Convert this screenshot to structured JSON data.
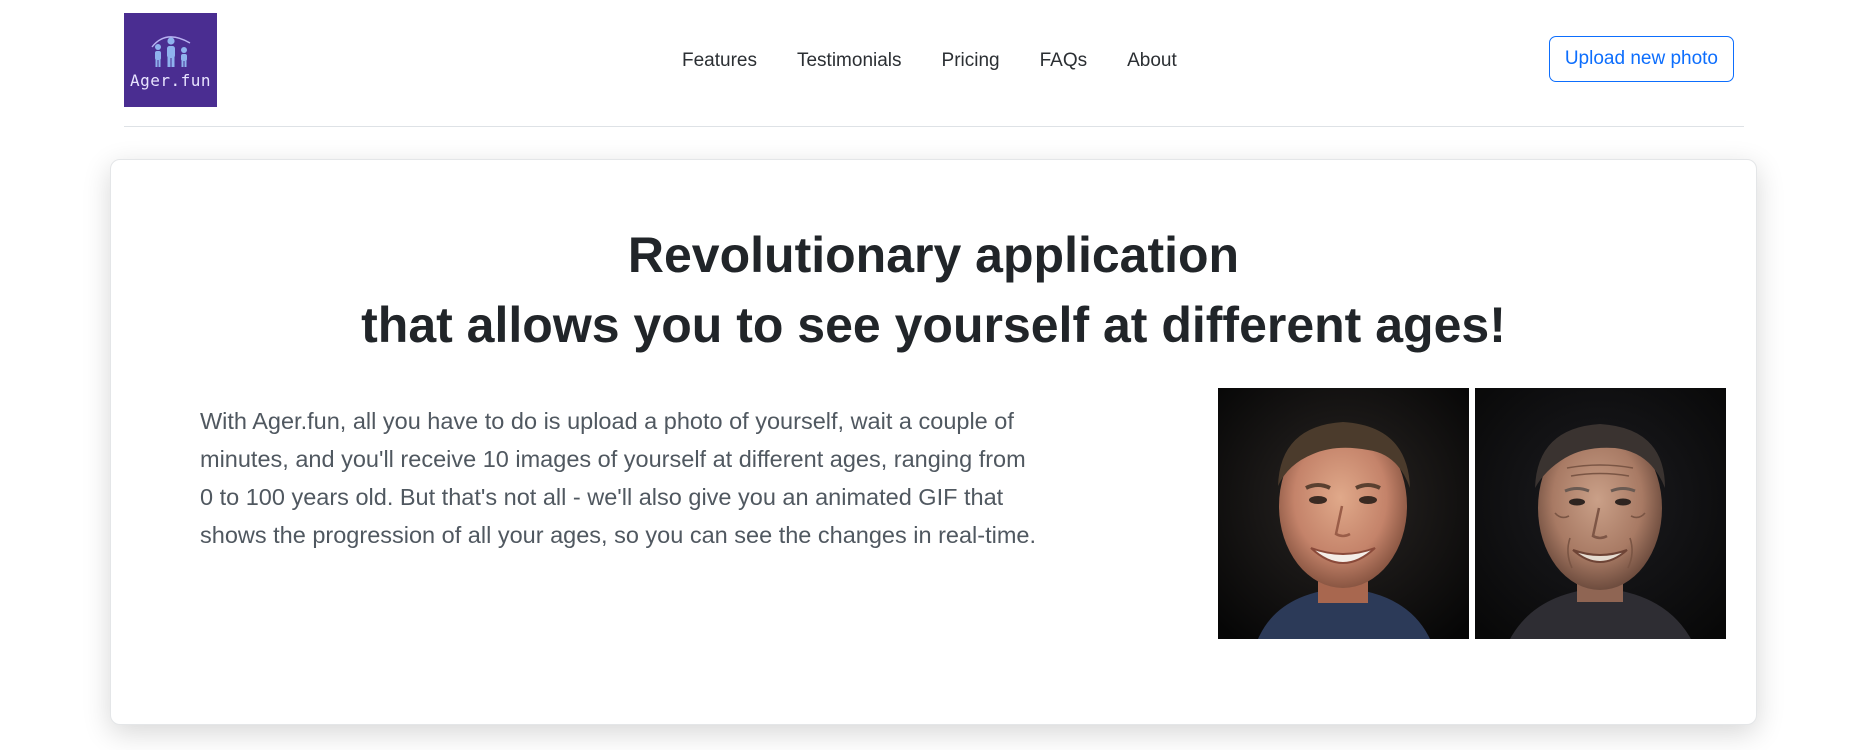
{
  "logo": {
    "text": "Ager.fun",
    "bg_color": "#4a2d91"
  },
  "nav": {
    "items": [
      {
        "label": "Features"
      },
      {
        "label": "Testimonials"
      },
      {
        "label": "Pricing"
      },
      {
        "label": "FAQs"
      },
      {
        "label": "About"
      }
    ]
  },
  "header": {
    "upload_label": "Upload new photo",
    "accent_color": "#0d6efd"
  },
  "hero": {
    "title_line1": "Revolutionary application",
    "title_line2": "that allows you to see yourself at different ages!",
    "description": "With Ager.fun, all you have to do is upload a photo of yourself, wait a couple of minutes, and you'll receive 10 images of yourself at different ages, ranging from 0 to 100 years old. But that's not all - we'll also give you an animated GIF that shows the progression of all your ages, so you can see the changes in real-time.",
    "images": [
      {
        "icon": "young-face-photo"
      },
      {
        "icon": "elderly-face-photo"
      }
    ]
  }
}
